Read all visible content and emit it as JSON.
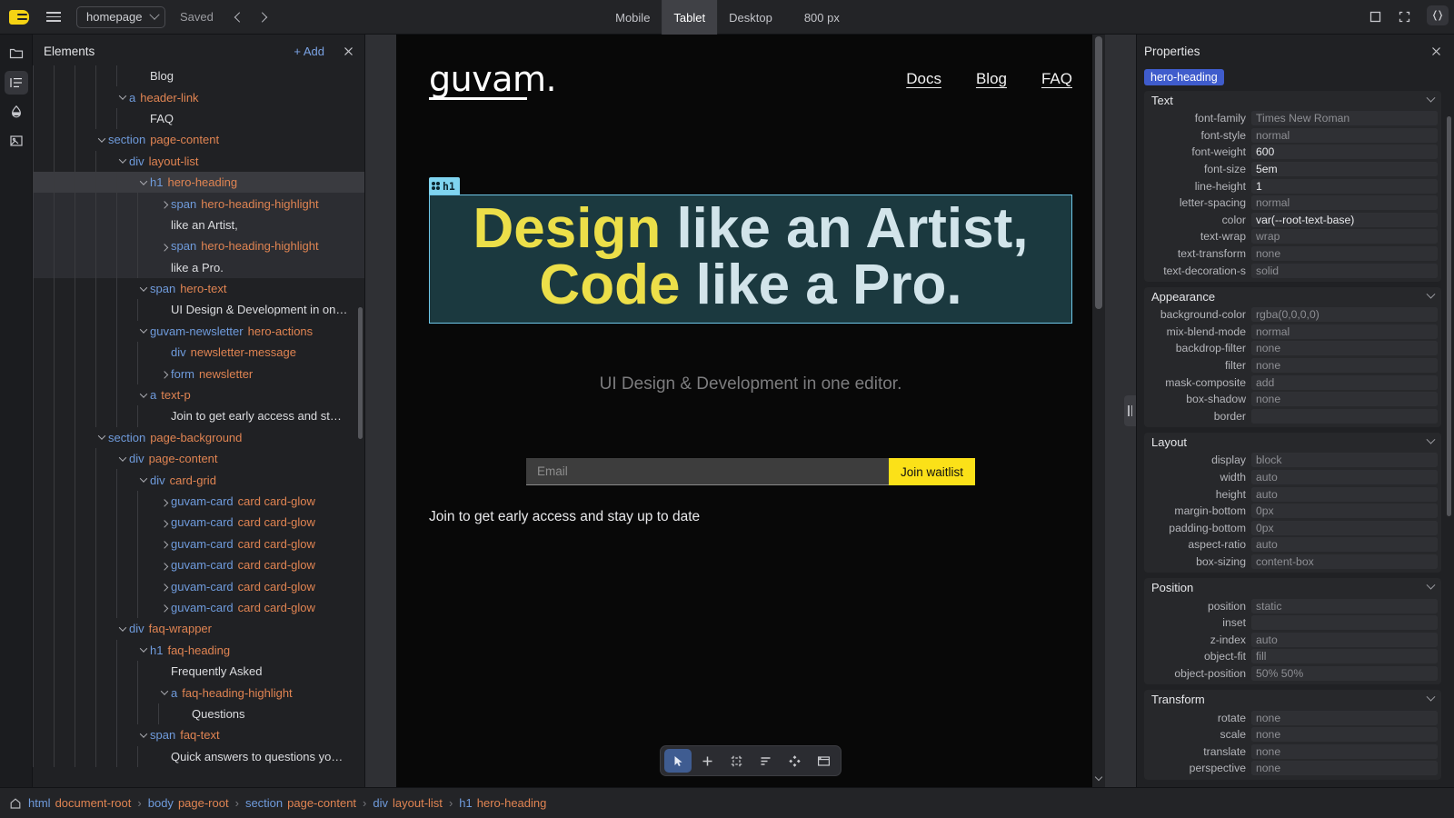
{
  "topbar": {
    "logo_icon": "app-logo-icon",
    "menu_icon": "hamburger-menu-icon",
    "page_select_value": "homepage",
    "save_status": "Saved",
    "nav_back_icon": "chevron-left-icon",
    "nav_forward_icon": "chevron-right-icon",
    "viewports": [
      {
        "label": "Mobile",
        "active": false
      },
      {
        "label": "Tablet",
        "active": true
      },
      {
        "label": "Desktop",
        "active": false
      }
    ],
    "viewport_size": "800 px",
    "window_controls": [
      "maximize-icon",
      "fullscreen-icon",
      "close-icon"
    ]
  },
  "rail": {
    "items": [
      {
        "icon": "folder-icon",
        "active": false
      },
      {
        "icon": "layers-list-icon",
        "active": true
      },
      {
        "icon": "droplet-icon",
        "active": false
      },
      {
        "icon": "image-icon",
        "active": false
      }
    ]
  },
  "elements_panel": {
    "title": "Elements",
    "add_label": "+ Add",
    "close_icon": "close-icon",
    "tree": [
      {
        "depth": 5,
        "twisty": "none",
        "text": "Blog"
      },
      {
        "depth": 4,
        "twisty": "open",
        "tag": "a",
        "cls": "header-link"
      },
      {
        "depth": 5,
        "twisty": "none",
        "text": "FAQ"
      },
      {
        "depth": 3,
        "twisty": "open",
        "tag": "section",
        "cls": "page-content"
      },
      {
        "depth": 4,
        "twisty": "open",
        "tag": "div",
        "cls": "layout-list"
      },
      {
        "depth": 5,
        "twisty": "open",
        "tag": "h1",
        "cls": "hero-heading",
        "state": "selected"
      },
      {
        "depth": 6,
        "twisty": "closed",
        "tag": "span",
        "cls": "hero-heading-highlight",
        "state": "in-sel"
      },
      {
        "depth": 6,
        "twisty": "none",
        "text": "like an Artist,",
        "state": "in-sel"
      },
      {
        "depth": 6,
        "twisty": "closed",
        "tag": "span",
        "cls": "hero-heading-highlight",
        "state": "in-sel"
      },
      {
        "depth": 6,
        "twisty": "none",
        "text": "like a Pro.",
        "state": "in-sel"
      },
      {
        "depth": 5,
        "twisty": "open",
        "tag": "span",
        "cls": "hero-text"
      },
      {
        "depth": 6,
        "twisty": "none",
        "text": "UI Design & Development in on…"
      },
      {
        "depth": 5,
        "twisty": "open",
        "tag": "guvam-newsletter",
        "cls": "hero-actions"
      },
      {
        "depth": 6,
        "twisty": "none",
        "tag": "div",
        "cls": "newsletter-message"
      },
      {
        "depth": 6,
        "twisty": "closed",
        "tag": "form",
        "cls": "newsletter"
      },
      {
        "depth": 5,
        "twisty": "open",
        "tag": "a",
        "cls": "text-p"
      },
      {
        "depth": 6,
        "twisty": "none",
        "text": "Join to get early access and st…"
      },
      {
        "depth": 3,
        "twisty": "open",
        "tag": "section",
        "cls": "page-background"
      },
      {
        "depth": 4,
        "twisty": "open",
        "tag": "div",
        "cls": "page-content"
      },
      {
        "depth": 5,
        "twisty": "open",
        "tag": "div",
        "cls": "card-grid"
      },
      {
        "depth": 6,
        "twisty": "closed",
        "tag": "guvam-card",
        "cls": "card card-glow"
      },
      {
        "depth": 6,
        "twisty": "closed",
        "tag": "guvam-card",
        "cls": "card card-glow"
      },
      {
        "depth": 6,
        "twisty": "closed",
        "tag": "guvam-card",
        "cls": "card card-glow"
      },
      {
        "depth": 6,
        "twisty": "closed",
        "tag": "guvam-card",
        "cls": "card card-glow"
      },
      {
        "depth": 6,
        "twisty": "closed",
        "tag": "guvam-card",
        "cls": "card card-glow"
      },
      {
        "depth": 6,
        "twisty": "closed",
        "tag": "guvam-card",
        "cls": "card card-glow"
      },
      {
        "depth": 4,
        "twisty": "open",
        "tag": "div",
        "cls": "faq-wrapper"
      },
      {
        "depth": 5,
        "twisty": "open",
        "tag": "h1",
        "cls": "faq-heading"
      },
      {
        "depth": 6,
        "twisty": "none",
        "text": "Frequently Asked"
      },
      {
        "depth": 6,
        "twisty": "open",
        "tag": "a",
        "cls": "faq-heading-highlight"
      },
      {
        "depth": 7,
        "twisty": "none",
        "text": "Questions"
      },
      {
        "depth": 5,
        "twisty": "open",
        "tag": "span",
        "cls": "faq-text"
      },
      {
        "depth": 6,
        "twisty": "none",
        "text": "Quick answers to questions yo…"
      }
    ]
  },
  "canvas": {
    "site": {
      "logo": "guvam.",
      "nav": [
        "Docs",
        "Blog",
        "FAQ"
      ],
      "hero_badge": "h1",
      "hero_heading_parts": [
        {
          "text": "Design",
          "highlight": true
        },
        {
          "text": " like an Artist, ",
          "highlight": false
        },
        {
          "text": "Code",
          "highlight": true
        },
        {
          "text": " like a Pro.",
          "highlight": false
        }
      ],
      "hero_subtitle": "UI Design & Development in one editor.",
      "email_placeholder": "Email",
      "email_value": "",
      "join_button": "Join waitlist",
      "join_note": "Join to get early access and stay up to date"
    },
    "toolbar": [
      {
        "icon": "cursor-select-icon",
        "active": true
      },
      {
        "icon": "add-plus-icon",
        "active": false
      },
      {
        "icon": "frame-icon",
        "active": false
      },
      {
        "icon": "align-left-icon",
        "active": false
      },
      {
        "icon": "components-diamond-icon",
        "active": false
      },
      {
        "icon": "panel-layout-icon",
        "active": false
      }
    ],
    "resize_handle_icon": "drag-handle-icon"
  },
  "properties": {
    "title": "Properties",
    "close_icon": "close-icon",
    "code_icon": "code-braces-icon",
    "selected_element": "hero-heading",
    "groups": [
      {
        "name": "Text",
        "rows": [
          {
            "key": "font-family",
            "value": "Times New Roman",
            "set": false
          },
          {
            "key": "font-style",
            "value": "normal",
            "set": false
          },
          {
            "key": "font-weight",
            "value": "600",
            "set": true
          },
          {
            "key": "font-size",
            "value": "5em",
            "set": true
          },
          {
            "key": "line-height",
            "value": "1",
            "set": true
          },
          {
            "key": "letter-spacing",
            "value": "normal",
            "set": false
          },
          {
            "key": "color",
            "value": "var(--root-text-base)",
            "set": true
          },
          {
            "key": "text-wrap",
            "value": "wrap",
            "set": false
          },
          {
            "key": "text-transform",
            "value": "none",
            "set": false
          },
          {
            "key": "text-decoration-s",
            "value": "solid",
            "set": false
          }
        ]
      },
      {
        "name": "Appearance",
        "rows": [
          {
            "key": "background-color",
            "value": "rgba(0,0,0,0)",
            "set": false
          },
          {
            "key": "mix-blend-mode",
            "value": "normal",
            "set": false
          },
          {
            "key": "backdrop-filter",
            "value": "none",
            "set": false
          },
          {
            "key": "filter",
            "value": "none",
            "set": false
          },
          {
            "key": "mask-composite",
            "value": "add",
            "set": false
          },
          {
            "key": "box-shadow",
            "value": "none",
            "set": false
          },
          {
            "key": "border",
            "value": "",
            "set": false
          }
        ]
      },
      {
        "name": "Layout",
        "rows": [
          {
            "key": "display",
            "value": "block",
            "set": false
          },
          {
            "key": "width",
            "value": "auto",
            "set": false
          },
          {
            "key": "height",
            "value": "auto",
            "set": false
          },
          {
            "key": "margin-bottom",
            "value": "0px",
            "set": false
          },
          {
            "key": "padding-bottom",
            "value": "0px",
            "set": false
          },
          {
            "key": "aspect-ratio",
            "value": "auto",
            "set": false
          },
          {
            "key": "box-sizing",
            "value": "content-box",
            "set": false
          }
        ]
      },
      {
        "name": "Position",
        "rows": [
          {
            "key": "position",
            "value": "static",
            "set": false
          },
          {
            "key": "inset",
            "value": "",
            "set": false
          },
          {
            "key": "z-index",
            "value": "auto",
            "set": false
          },
          {
            "key": "object-fit",
            "value": "fill",
            "set": false
          },
          {
            "key": "object-position",
            "value": "50% 50%",
            "set": false
          }
        ]
      },
      {
        "name": "Transform",
        "rows": [
          {
            "key": "rotate",
            "value": "none",
            "set": false
          },
          {
            "key": "scale",
            "value": "none",
            "set": false
          },
          {
            "key": "translate",
            "value": "none",
            "set": false
          },
          {
            "key": "perspective",
            "value": "none",
            "set": false
          }
        ]
      }
    ]
  },
  "breadcrumb": {
    "home_icon": "home-icon",
    "separator": "›",
    "items": [
      {
        "tag": "html",
        "cls": "document-root"
      },
      {
        "tag": "body",
        "cls": "page-root"
      },
      {
        "tag": "section",
        "cls": "page-content"
      },
      {
        "tag": "div",
        "cls": "layout-list"
      },
      {
        "tag": "h1",
        "cls": "hero-heading"
      }
    ]
  }
}
